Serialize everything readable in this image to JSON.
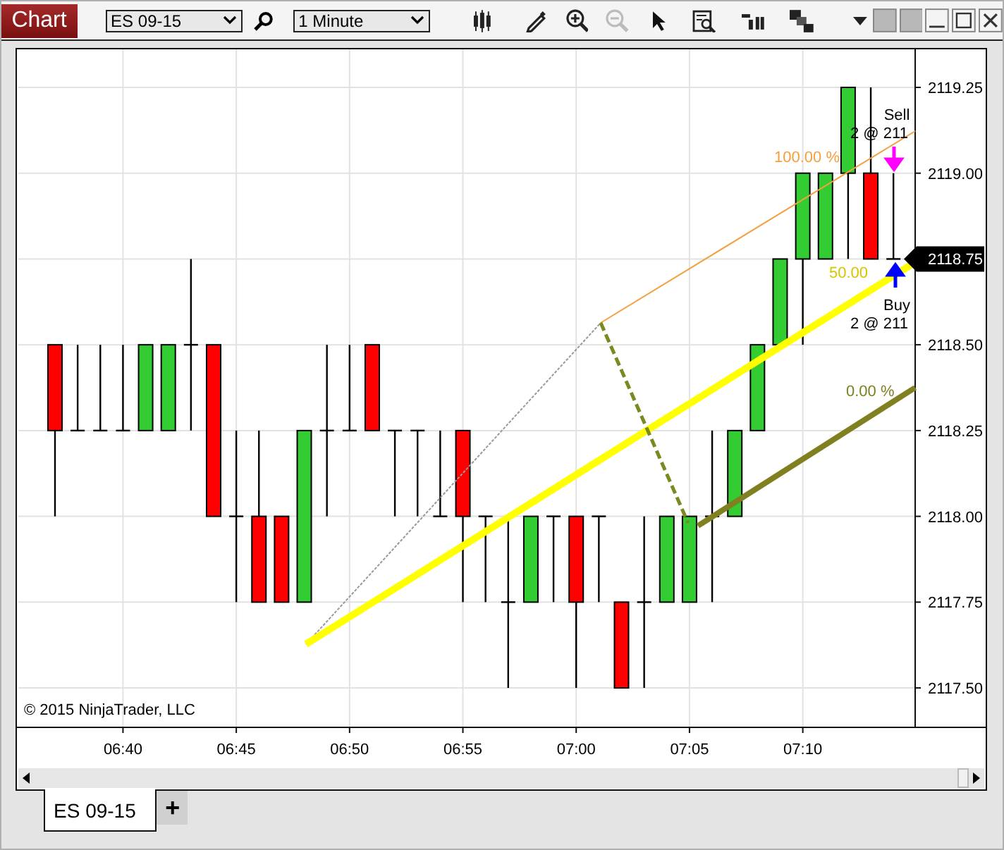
{
  "toolbar": {
    "title": "Chart",
    "instrument": "ES 09-15",
    "interval": "1 Minute"
  },
  "chart": {
    "price_labels": [
      "2119.25",
      "2119.00",
      "2118.50",
      "2118.25",
      "2118.00",
      "2117.75",
      "2117.50"
    ],
    "time_labels": [
      "06:40",
      "06:45",
      "06:50",
      "06:55",
      "07:00",
      "07:05",
      "07:10"
    ],
    "copyright": "© 2015 NinjaTrader, LLC",
    "last_price": "2118.75",
    "fib_levels": [
      {
        "label": "100.00 %",
        "color": "#f4a040"
      },
      {
        "label": "50.00",
        "color": "#d8c400"
      },
      {
        "label": "0.00 %",
        "color": "#808020"
      }
    ],
    "executions": [
      {
        "kind": "sell",
        "action": "Sell",
        "detail": "2 @ 211"
      },
      {
        "kind": "buy",
        "action": "Buy",
        "detail": "2 @ 211"
      }
    ]
  },
  "tabs": [
    {
      "label": "ES 09-15",
      "selected": true
    }
  ],
  "add_tab": "+"
}
